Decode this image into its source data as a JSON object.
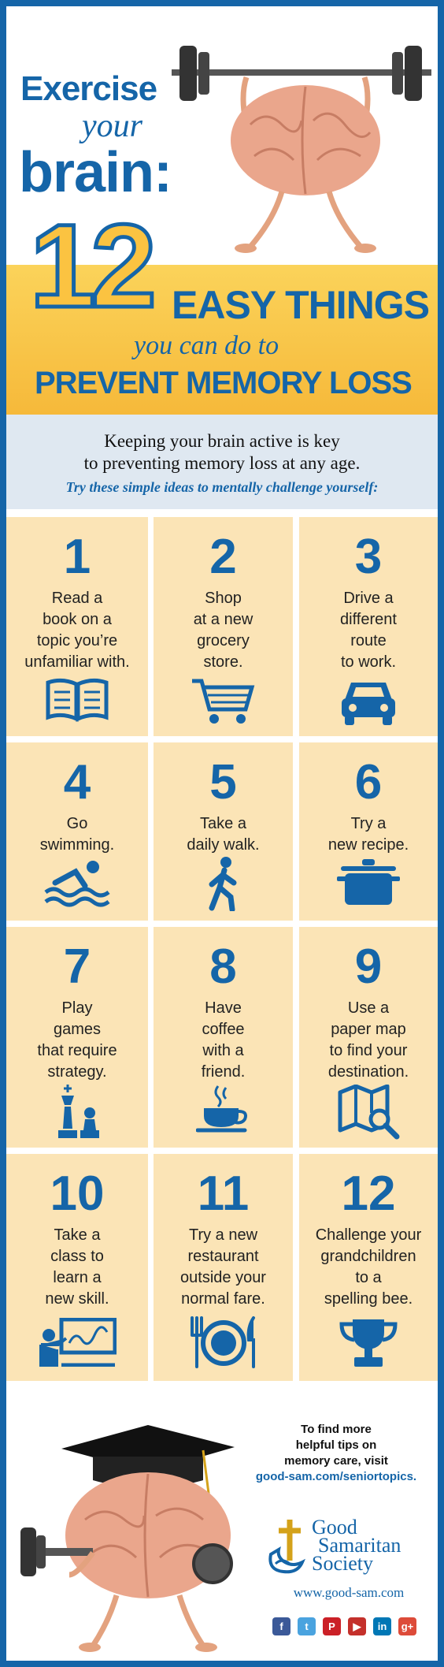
{
  "header": {
    "line_exercise": "Exercise",
    "line_your": "your",
    "line_brain": "brain:",
    "number": "12",
    "line_easy": "EASY THINGS",
    "line_youcan": "you can do to",
    "line_prevent": "PREVENT MEMORY LOSS"
  },
  "intro": {
    "line1": "Keeping your brain active is key",
    "line2": "to preventing memory loss at any age.",
    "line3": "Try these simple ideas to mentally challenge yourself:"
  },
  "tips": [
    {
      "num": "1",
      "text": "Read a\nbook on a\ntopic you’re\nunfamiliar with.",
      "icon": "book-icon"
    },
    {
      "num": "2",
      "text": "Shop\nat a new\ngrocery\nstore.",
      "icon": "shopping-cart-icon"
    },
    {
      "num": "3",
      "text": "Drive a\ndifferent\nroute\nto work.",
      "icon": "car-icon"
    },
    {
      "num": "4",
      "text": "Go\nswimming.",
      "icon": "swimmer-icon"
    },
    {
      "num": "5",
      "text": "Take a\ndaily walk.",
      "icon": "walker-icon"
    },
    {
      "num": "6",
      "text": "Try a\nnew recipe.",
      "icon": "cooking-pot-icon"
    },
    {
      "num": "7",
      "text": "Play\ngames\nthat require\nstrategy.",
      "icon": "chess-icon"
    },
    {
      "num": "8",
      "text": "Have\ncoffee\nwith a\nfriend.",
      "icon": "coffee-cup-icon"
    },
    {
      "num": "9",
      "text": "Use a\npaper map\nto find your\ndestination.",
      "icon": "map-icon"
    },
    {
      "num": "10",
      "text": "Take a\nclass to\nlearn a\nnew skill.",
      "icon": "teacher-icon"
    },
    {
      "num": "11",
      "text": "Try a new\nrestaurant\noutside your\nnormal fare.",
      "icon": "plate-utensils-icon"
    },
    {
      "num": "12",
      "text": "Challenge your\ngrandchildren\nto a\nspelling bee.",
      "icon": "trophy-icon"
    }
  ],
  "footer": {
    "tips_line1": "To find more",
    "tips_line2": "helpful tips on",
    "tips_line3": "memory care, visit",
    "tips_link": "good-sam.com/seniortopics.",
    "logo_line1": "Good",
    "logo_line2": "Samaritan",
    "logo_line3": "Society",
    "website": "www.good-sam.com",
    "social": [
      {
        "label": "f",
        "icon": "facebook-icon",
        "color": "#3b5998"
      },
      {
        "label": "t",
        "icon": "twitter-icon",
        "color": "#4aa3df"
      },
      {
        "label": "P",
        "icon": "pinterest-icon",
        "color": "#cb2027"
      },
      {
        "label": "▶",
        "icon": "youtube-icon",
        "color": "#c4302b"
      },
      {
        "label": "in",
        "icon": "linkedin-icon",
        "color": "#0077b5"
      },
      {
        "label": "g+",
        "icon": "google-plus-icon",
        "color": "#dd4b39"
      }
    ]
  },
  "colors": {
    "brand_blue": "#1565a8",
    "yellow": "#fbc341",
    "tile": "#fbe4b6"
  }
}
